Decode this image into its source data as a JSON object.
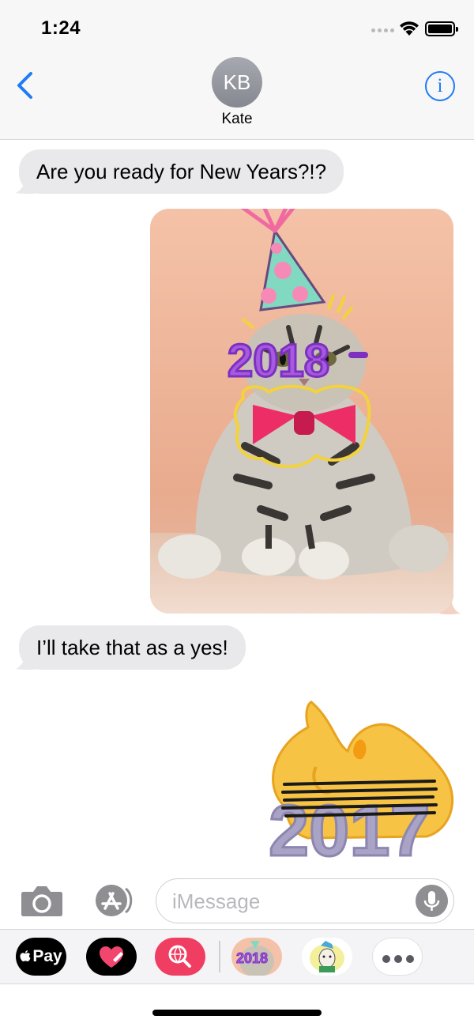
{
  "status_bar": {
    "time": "1:24"
  },
  "header": {
    "contact_initials": "KB",
    "contact_name": "Kate",
    "info_icon": "i"
  },
  "messages": [
    {
      "type": "text",
      "direction": "incoming",
      "text": "Are you ready for New Years?!?"
    },
    {
      "type": "photo",
      "direction": "outgoing",
      "description_icon": "cat-with-party-hat-and-2018-glasses"
    },
    {
      "type": "text",
      "direction": "incoming",
      "text": "I’ll take that as a yes!"
    },
    {
      "type": "sticker",
      "direction": "outgoing",
      "sticker_text": "2017"
    }
  ],
  "photo_sticker_text": "2018",
  "input": {
    "placeholder": "iMessage"
  },
  "app_drawer": {
    "apple_pay_label": "Pay",
    "apps": [
      "apple-pay",
      "digital-touch",
      "web-images-search",
      "2018-stickers",
      "llama-stickers",
      "more"
    ]
  },
  "colors": {
    "accent": "#1f7cf4",
    "incoming_bubble": "#e9e9eb",
    "header_bg": "#f7f7f7",
    "search_app": "#f03d62"
  }
}
